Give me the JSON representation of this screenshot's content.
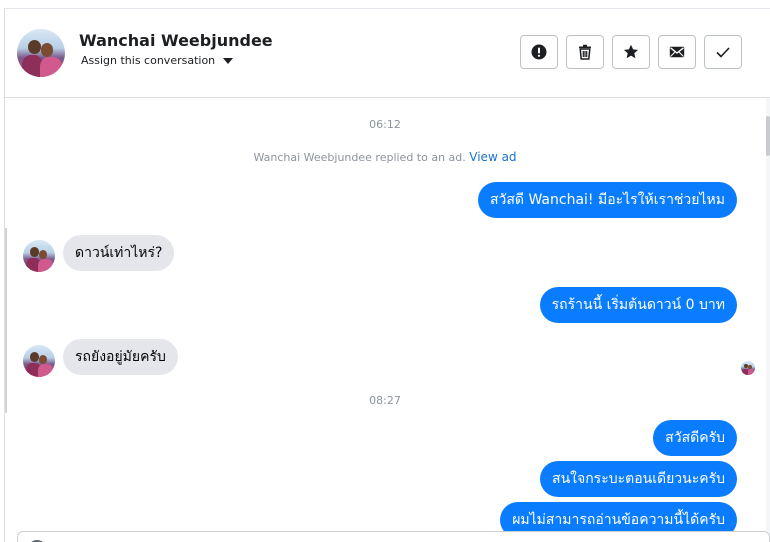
{
  "header": {
    "contact_name": "Wanchai Weebjundee",
    "assign_label": "Assign this conversation",
    "actions": [
      {
        "name": "report-button",
        "icon": "exclamation-circle-icon"
      },
      {
        "name": "delete-button",
        "icon": "trash-icon"
      },
      {
        "name": "star-button",
        "icon": "star-icon"
      },
      {
        "name": "mark-unread-button",
        "icon": "envelope-icon"
      },
      {
        "name": "mark-done-button",
        "icon": "checkmark-icon"
      }
    ]
  },
  "conversation": {
    "time_1": "06:12",
    "system_message": "Wanchai Weebjundee replied to an ad.",
    "system_link": "View ad",
    "messages": [
      {
        "direction": "out",
        "text": "สวัสดี Wanchai! มีอะไรให้เราช่วยไหม"
      },
      {
        "direction": "in",
        "text": "ดาวน์เท่าไหร่?"
      },
      {
        "direction": "out",
        "text": "รถร้านนี้ เริ่มต้นดาวน์ 0 บาท"
      },
      {
        "direction": "in",
        "text": "รถยังอยู่มัยครับ"
      }
    ],
    "time_2": "08:27",
    "messages_2": [
      {
        "direction": "out",
        "text": "สวัสดีครับ"
      },
      {
        "direction": "out",
        "text": "สนใจกระบะตอนเดียวนะครับ"
      },
      {
        "direction": "out",
        "text": "ผมไม่สามารถอ่านข้อความนี้ได้ครับ"
      }
    ]
  },
  "colors": {
    "outgoing_bubble": "#0a7cff",
    "incoming_bubble": "#e4e6eb",
    "link": "#1a73c8",
    "timestamp": "#8d949e"
  }
}
